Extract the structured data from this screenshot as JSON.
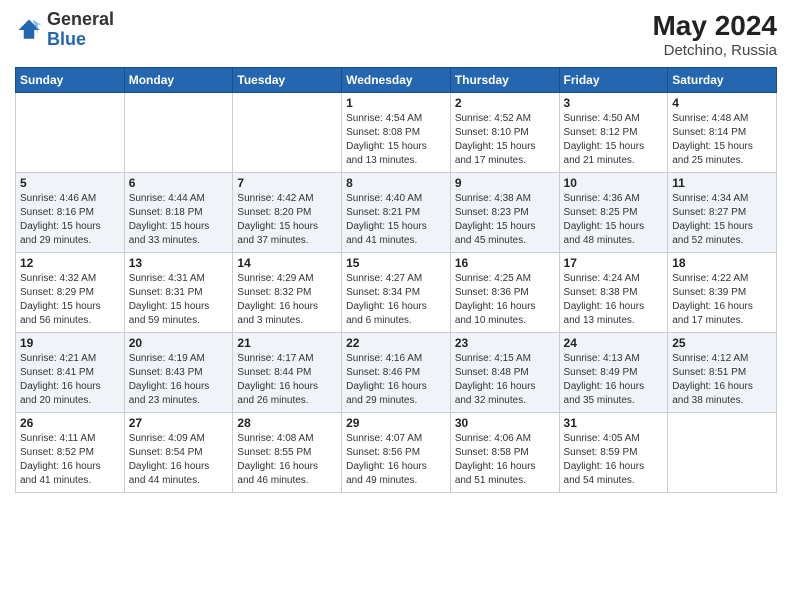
{
  "header": {
    "logo_general": "General",
    "logo_blue": "Blue",
    "month_year": "May 2024",
    "location": "Detchino, Russia"
  },
  "weekdays": [
    "Sunday",
    "Monday",
    "Tuesday",
    "Wednesday",
    "Thursday",
    "Friday",
    "Saturday"
  ],
  "weeks": [
    [
      {
        "day": "",
        "info": ""
      },
      {
        "day": "",
        "info": ""
      },
      {
        "day": "",
        "info": ""
      },
      {
        "day": "1",
        "info": "Sunrise: 4:54 AM\nSunset: 8:08 PM\nDaylight: 15 hours\nand 13 minutes."
      },
      {
        "day": "2",
        "info": "Sunrise: 4:52 AM\nSunset: 8:10 PM\nDaylight: 15 hours\nand 17 minutes."
      },
      {
        "day": "3",
        "info": "Sunrise: 4:50 AM\nSunset: 8:12 PM\nDaylight: 15 hours\nand 21 minutes."
      },
      {
        "day": "4",
        "info": "Sunrise: 4:48 AM\nSunset: 8:14 PM\nDaylight: 15 hours\nand 25 minutes."
      }
    ],
    [
      {
        "day": "5",
        "info": "Sunrise: 4:46 AM\nSunset: 8:16 PM\nDaylight: 15 hours\nand 29 minutes."
      },
      {
        "day": "6",
        "info": "Sunrise: 4:44 AM\nSunset: 8:18 PM\nDaylight: 15 hours\nand 33 minutes."
      },
      {
        "day": "7",
        "info": "Sunrise: 4:42 AM\nSunset: 8:20 PM\nDaylight: 15 hours\nand 37 minutes."
      },
      {
        "day": "8",
        "info": "Sunrise: 4:40 AM\nSunset: 8:21 PM\nDaylight: 15 hours\nand 41 minutes."
      },
      {
        "day": "9",
        "info": "Sunrise: 4:38 AM\nSunset: 8:23 PM\nDaylight: 15 hours\nand 45 minutes."
      },
      {
        "day": "10",
        "info": "Sunrise: 4:36 AM\nSunset: 8:25 PM\nDaylight: 15 hours\nand 48 minutes."
      },
      {
        "day": "11",
        "info": "Sunrise: 4:34 AM\nSunset: 8:27 PM\nDaylight: 15 hours\nand 52 minutes."
      }
    ],
    [
      {
        "day": "12",
        "info": "Sunrise: 4:32 AM\nSunset: 8:29 PM\nDaylight: 15 hours\nand 56 minutes."
      },
      {
        "day": "13",
        "info": "Sunrise: 4:31 AM\nSunset: 8:31 PM\nDaylight: 15 hours\nand 59 minutes."
      },
      {
        "day": "14",
        "info": "Sunrise: 4:29 AM\nSunset: 8:32 PM\nDaylight: 16 hours\nand 3 minutes."
      },
      {
        "day": "15",
        "info": "Sunrise: 4:27 AM\nSunset: 8:34 PM\nDaylight: 16 hours\nand 6 minutes."
      },
      {
        "day": "16",
        "info": "Sunrise: 4:25 AM\nSunset: 8:36 PM\nDaylight: 16 hours\nand 10 minutes."
      },
      {
        "day": "17",
        "info": "Sunrise: 4:24 AM\nSunset: 8:38 PM\nDaylight: 16 hours\nand 13 minutes."
      },
      {
        "day": "18",
        "info": "Sunrise: 4:22 AM\nSunset: 8:39 PM\nDaylight: 16 hours\nand 17 minutes."
      }
    ],
    [
      {
        "day": "19",
        "info": "Sunrise: 4:21 AM\nSunset: 8:41 PM\nDaylight: 16 hours\nand 20 minutes."
      },
      {
        "day": "20",
        "info": "Sunrise: 4:19 AM\nSunset: 8:43 PM\nDaylight: 16 hours\nand 23 minutes."
      },
      {
        "day": "21",
        "info": "Sunrise: 4:17 AM\nSunset: 8:44 PM\nDaylight: 16 hours\nand 26 minutes."
      },
      {
        "day": "22",
        "info": "Sunrise: 4:16 AM\nSunset: 8:46 PM\nDaylight: 16 hours\nand 29 minutes."
      },
      {
        "day": "23",
        "info": "Sunrise: 4:15 AM\nSunset: 8:48 PM\nDaylight: 16 hours\nand 32 minutes."
      },
      {
        "day": "24",
        "info": "Sunrise: 4:13 AM\nSunset: 8:49 PM\nDaylight: 16 hours\nand 35 minutes."
      },
      {
        "day": "25",
        "info": "Sunrise: 4:12 AM\nSunset: 8:51 PM\nDaylight: 16 hours\nand 38 minutes."
      }
    ],
    [
      {
        "day": "26",
        "info": "Sunrise: 4:11 AM\nSunset: 8:52 PM\nDaylight: 16 hours\nand 41 minutes."
      },
      {
        "day": "27",
        "info": "Sunrise: 4:09 AM\nSunset: 8:54 PM\nDaylight: 16 hours\nand 44 minutes."
      },
      {
        "day": "28",
        "info": "Sunrise: 4:08 AM\nSunset: 8:55 PM\nDaylight: 16 hours\nand 46 minutes."
      },
      {
        "day": "29",
        "info": "Sunrise: 4:07 AM\nSunset: 8:56 PM\nDaylight: 16 hours\nand 49 minutes."
      },
      {
        "day": "30",
        "info": "Sunrise: 4:06 AM\nSunset: 8:58 PM\nDaylight: 16 hours\nand 51 minutes."
      },
      {
        "day": "31",
        "info": "Sunrise: 4:05 AM\nSunset: 8:59 PM\nDaylight: 16 hours\nand 54 minutes."
      },
      {
        "day": "",
        "info": ""
      }
    ]
  ]
}
